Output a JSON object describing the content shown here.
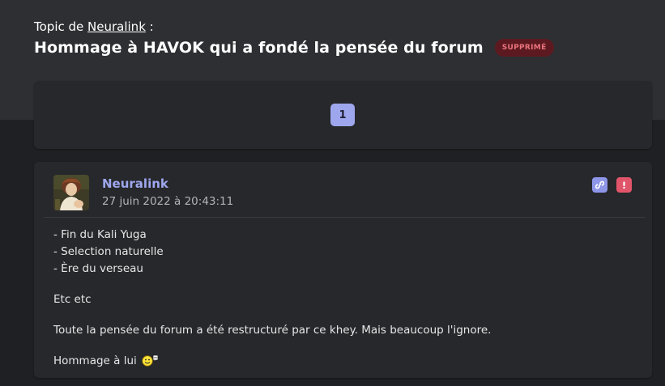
{
  "topic": {
    "prefix": "Topic de",
    "author": "Neuralink",
    "suffix": " :",
    "title": "Hommage à HAVOK qui a fondé la pensée du forum",
    "status_badge": "SUPPRIMÉ"
  },
  "pagination": {
    "current_page": "1"
  },
  "post": {
    "author": "Neuralink",
    "date": "27 juin 2022 à 20:43:11",
    "lines": [
      "- Fin du Kali Yuga",
      "- Selection naturelle",
      "- Ère du verseau"
    ],
    "paragraph_1": "Etc etc",
    "paragraph_2": "Toute la pensée du forum a été restructuré par ce khey. Mais beaucoup l'ignore.",
    "paragraph_3": "Hommage à lui",
    "link_icon": "link-icon",
    "report_icon": "exclamation-icon"
  },
  "colors": {
    "accent": "#9ea7ee",
    "badge_bg": "#5c1a20",
    "badge_text": "#e9737c",
    "report": "#e0556a"
  }
}
